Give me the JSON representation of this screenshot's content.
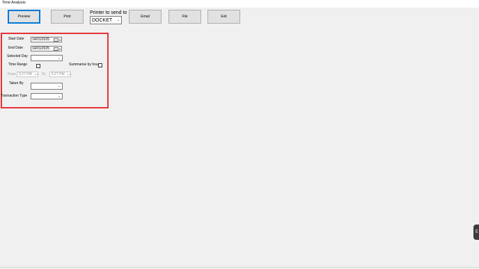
{
  "window": {
    "title": "Time Analysis"
  },
  "toolbar": {
    "preview": "Preview",
    "print": "Print",
    "printer_label": "Printer to send to",
    "printer_value": "DOCKET",
    "email": "Email",
    "file": "File",
    "exit": "Exit"
  },
  "filters": {
    "start_date_label": "Start Date",
    "start_date_value": "14/01/2025",
    "end_date_label": "End Date",
    "end_date_value": "14/01/2025",
    "selected_day_label": "Selected Day",
    "selected_day_value": "",
    "time_range_label": "Time Range",
    "summarise_label": "Summarise by hour",
    "from_label": "From",
    "from_value": "5:27 PM",
    "to_label": "To",
    "to_value": "5:27 PM",
    "taken_by_label": "Taken By",
    "taken_by_value": "",
    "transaction_type_label": "Transaction Type",
    "transaction_type_value": ""
  },
  "side_tab": {
    "label": "E"
  },
  "colors": {
    "highlight_box": "#e53238",
    "default_button_border": "#0078d7"
  }
}
